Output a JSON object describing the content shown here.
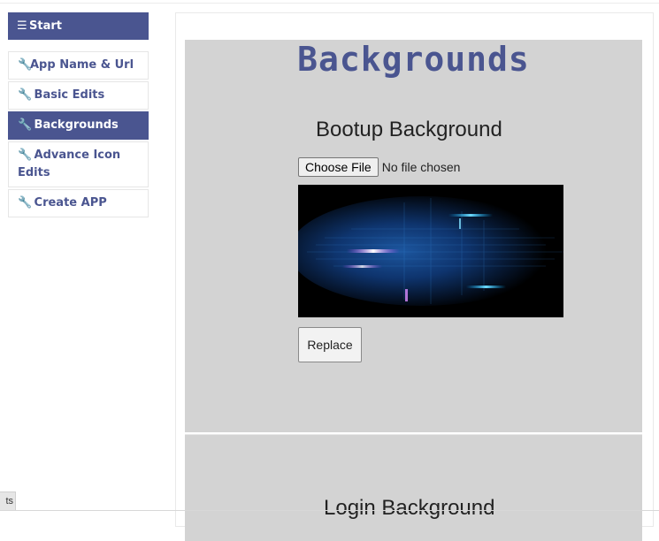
{
  "sidebar": {
    "items": [
      {
        "icon": "list-icon",
        "label": "Start",
        "active": true
      },
      {
        "icon": "wrench-icon",
        "label": "App Name & Url",
        "active": false
      },
      {
        "icon": "wrench-icon",
        "label": "Basic Edits",
        "active": false
      },
      {
        "icon": "wrench-icon",
        "label": "Backgrounds",
        "active": true
      },
      {
        "icon": "wrench-icon",
        "label": "Advance Icon Edits",
        "active": false
      },
      {
        "icon": "wrench-icon",
        "label": "Create APP",
        "active": false
      }
    ]
  },
  "main": {
    "title": "Backgrounds",
    "sections": [
      {
        "title": "Bootup Background",
        "file_button": "Choose File",
        "file_status": "No file chosen",
        "preview_image": "abstract-blue-light-streaks",
        "replace_label": "Replace"
      },
      {
        "title": "Login Background"
      }
    ]
  },
  "corner_tab": {
    "label": "ts"
  },
  "colors": {
    "accent": "#4a5590",
    "section_bg": "#d3d3d3",
    "page_bg": "#ffffff"
  }
}
